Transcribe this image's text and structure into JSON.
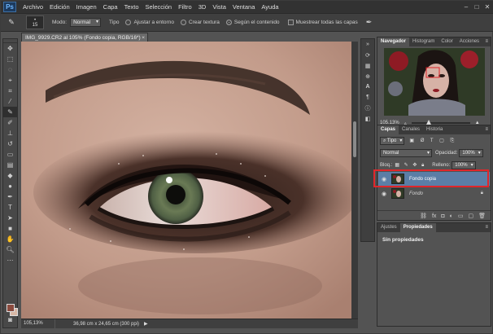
{
  "app": {
    "logo": "Ps"
  },
  "menu": [
    "Archivo",
    "Edición",
    "Imagen",
    "Capa",
    "Texto",
    "Selección",
    "Filtro",
    "3D",
    "Vista",
    "Ventana",
    "Ayuda"
  ],
  "window_controls": {
    "minimize": "–",
    "maximize": "□",
    "close": "✕"
  },
  "options_bar": {
    "brush_size": "15",
    "mode_label": "Modo:",
    "mode_value": "Normal",
    "type_label": "Tipo",
    "type_options": [
      {
        "label": "Ajustar a entorno",
        "selected": false
      },
      {
        "label": "Crear textura",
        "selected": false
      },
      {
        "label": "Según el contenido",
        "selected": true
      }
    ],
    "sample_all_layers_label": "Muestrear todas las capas",
    "sample_all_layers_checked": false
  },
  "document": {
    "tab_title": "IMG_9929.CR2 al 105% (Fondo copia, RGB/16*)",
    "tab_close": "×"
  },
  "status_bar": {
    "zoom": "105,13%",
    "info": "36,98 cm x 24,65 cm (300 ppi)",
    "arrow": "▶"
  },
  "navigator_panel": {
    "tabs": [
      "Navegador",
      "Histogram",
      "Color",
      "Acciones"
    ],
    "active_tab": "Navegador",
    "zoom": "105.13%"
  },
  "layers_panel": {
    "tabs": [
      "Capas",
      "Canales",
      "Historia"
    ],
    "active_tab": "Capas",
    "filter_label": "Tipo",
    "blend_mode": "Normal",
    "opacity_label": "Opacidad:",
    "opacity_value": "100%",
    "lock_label": "Bloq.:",
    "fill_label": "Relleno:",
    "fill_value": "100%",
    "layers": [
      {
        "name": "Fondo copia",
        "selected": true,
        "visible": true,
        "locked": false
      },
      {
        "name": "Fondo",
        "selected": false,
        "visible": true,
        "locked": true
      }
    ]
  },
  "properties_panel": {
    "tabs": [
      "Ajustes",
      "Propiedades"
    ],
    "active_tab": "Propiedades",
    "message": "Sin propiedades"
  },
  "colors": {
    "foreground": "#8a4a3e",
    "background": "#d9b8a6",
    "selection_highlight": "#e0262b",
    "layer_selected": "#5b7ea6"
  }
}
